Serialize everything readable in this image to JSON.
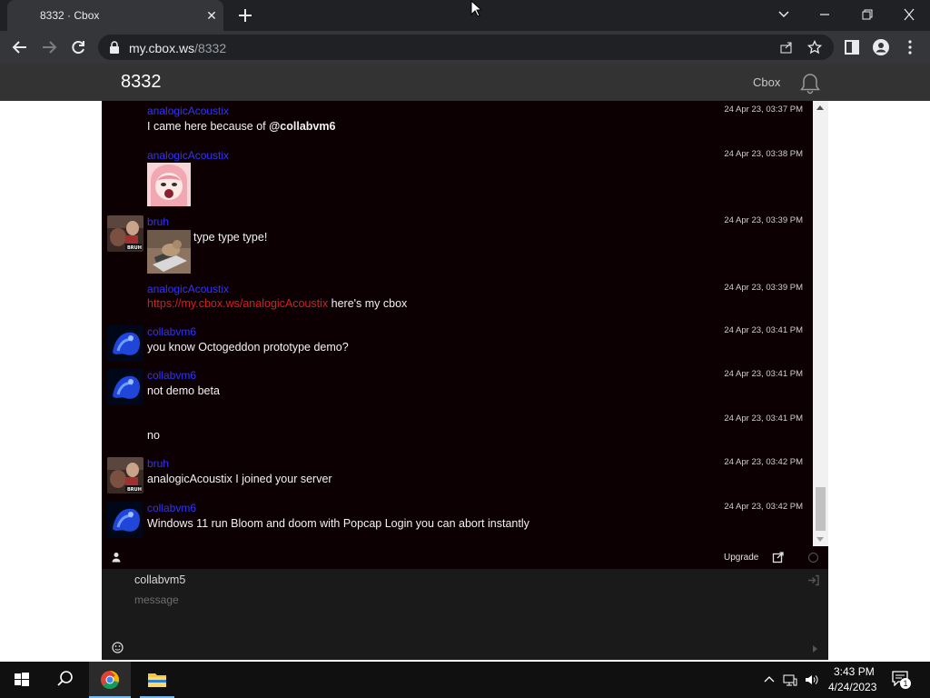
{
  "browser": {
    "tab_title": "8332 · Cbox",
    "url_host": "my.cbox.ws",
    "url_path": "/8332"
  },
  "page": {
    "title": "8332",
    "brand": "Cbox"
  },
  "messages": [
    {
      "author": "analogicAcoustix",
      "time": "24 Apr 23, 03:37 PM",
      "text_plain": "I came here because of ",
      "text_bold": "@collabvm6"
    },
    {
      "author": "analogicAcoustix",
      "time": "24 Apr 23, 03:38 PM"
    },
    {
      "author": "bruh",
      "time": "24 Apr 23, 03:39 PM",
      "text": "type type type!"
    },
    {
      "author": "analogicAcoustix",
      "time": "24 Apr 23, 03:39 PM",
      "link": "https://my.cbox.ws/analogicAcoustix",
      "text": " here's my cbox"
    },
    {
      "author": "collabvm6",
      "time": "24 Apr 23, 03:41 PM",
      "text": "you know Octogeddon prototype demo?"
    },
    {
      "author": "collabvm6",
      "time": "24 Apr 23, 03:41 PM",
      "text": "not demo beta"
    },
    {
      "author": "",
      "time": "24 Apr 23, 03:41 PM",
      "text": "no"
    },
    {
      "author": "bruh",
      "time": "24 Apr 23, 03:42 PM",
      "text": "analogicAcoustix I joined your server"
    },
    {
      "author": "collabvm6",
      "time": "24 Apr 23, 03:42 PM",
      "text": "Windows 11 run Bloom and doom with Popcap Login you can abort instantly"
    }
  ],
  "status_bar": {
    "upgrade_label": "Upgrade"
  },
  "compose": {
    "name_value": "collabvm5",
    "message_placeholder": "message"
  },
  "taskbar": {
    "time": "3:43 PM",
    "date": "4/24/2023",
    "notification_count": "1"
  },
  "colors": {
    "author": "#3232ff",
    "link": "#d22020",
    "chat_bg": "#0d0003",
    "header_bg": "#333333"
  }
}
